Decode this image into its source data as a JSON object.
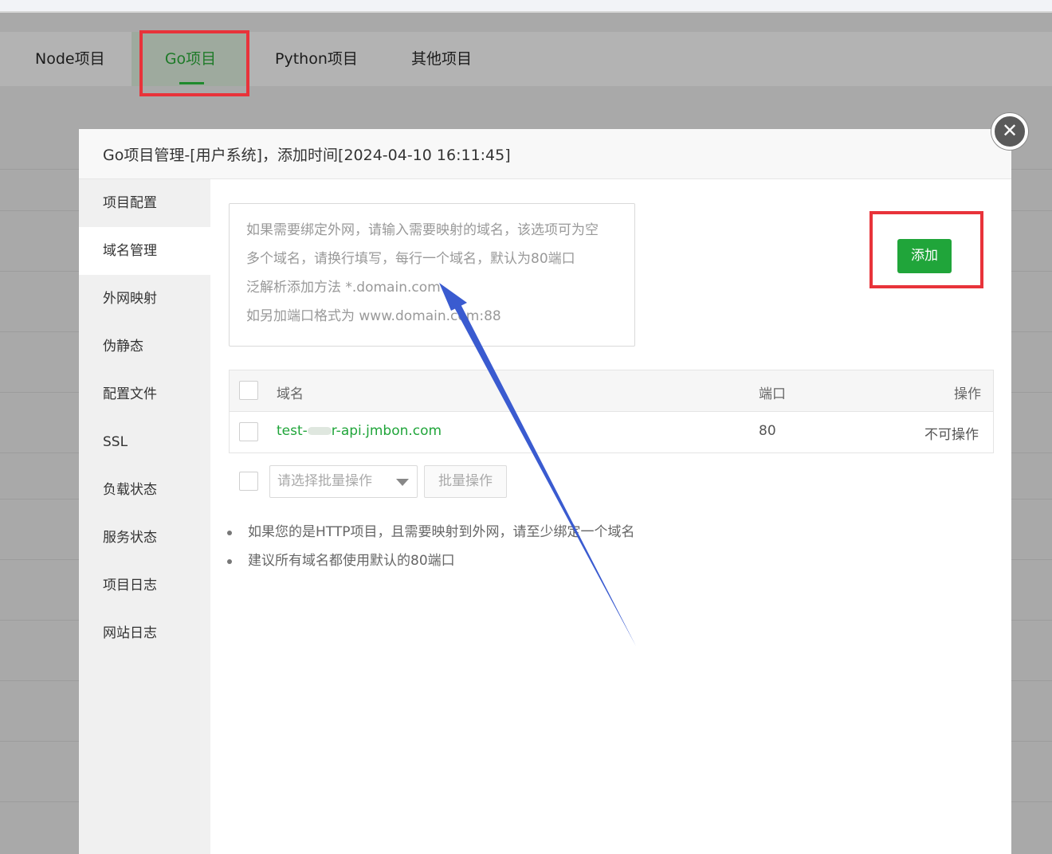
{
  "tabs": [
    {
      "label": "Node项目"
    },
    {
      "label": "Go项目",
      "active": true
    },
    {
      "label": "Python项目"
    },
    {
      "label": "其他项目"
    }
  ],
  "dialog": {
    "title": "Go项目管理-[用户系统]，添加时间[2024-04-10 16:11:45]",
    "close_icon": "close-icon",
    "sidebar": [
      {
        "label": "项目配置"
      },
      {
        "label": "域名管理",
        "active": true
      },
      {
        "label": "外网映射"
      },
      {
        "label": "伪静态"
      },
      {
        "label": "配置文件"
      },
      {
        "label": "SSL"
      },
      {
        "label": "负载状态"
      },
      {
        "label": "服务状态"
      },
      {
        "label": "项目日志"
      },
      {
        "label": "网站日志"
      }
    ],
    "domain_input": {
      "placeholder_lines": [
        "如果需要绑定外网，请输入需要映射的域名，该选项可为空",
        "多个域名，请换行填写，每行一个域名，默认为80端口",
        "泛解析添加方法 *.domain.com",
        "如另加端口格式为 www.domain.com:88"
      ]
    },
    "add_button": "添加",
    "table": {
      "headers": {
        "domain": "域名",
        "port": "端口",
        "action": "操作"
      },
      "rows": [
        {
          "domain_prefix": "test-",
          "domain_suffix": "r-api.jmbon.com",
          "port": "80",
          "action": "不可操作"
        }
      ]
    },
    "batch": {
      "select_placeholder": "请选择批量操作",
      "button": "批量操作"
    },
    "tips": [
      "如果您的是HTTP项目，且需要映射到外网，请至少绑定一个域名",
      "建议所有域名都使用默认的80端口"
    ]
  },
  "colors": {
    "accent": "#20a53a",
    "highlight": "#e8333a",
    "annotation_arrow": "#3a5bd0"
  }
}
